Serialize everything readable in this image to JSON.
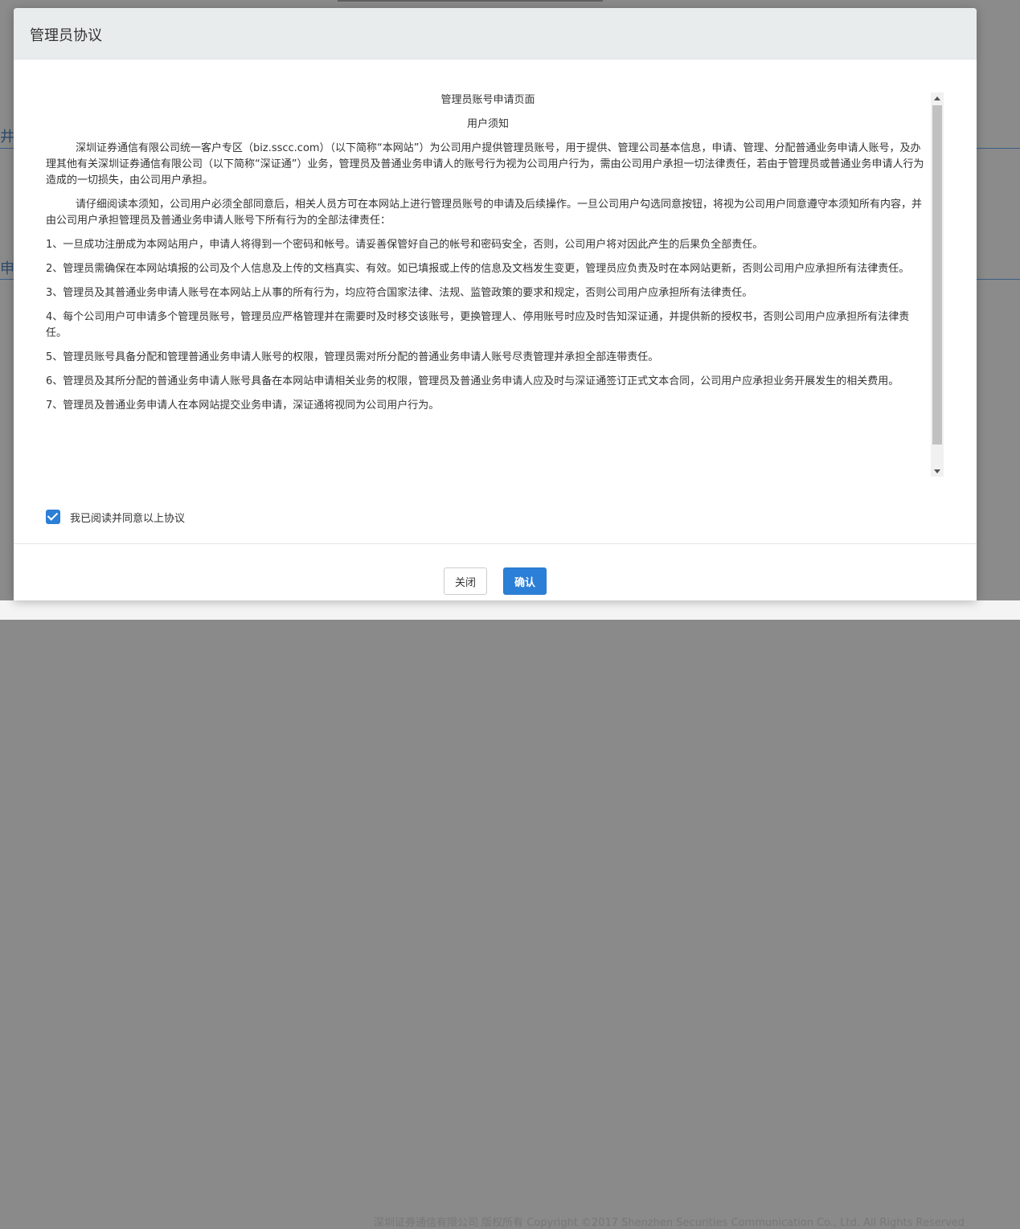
{
  "background": {
    "left_fragment_1": "井",
    "left_fragment_2": "申请",
    "footer_text": "深圳证券通信有限公司 版权所有  Copyright ©2017 Shenzhen Securities Communication Co., Ltd. All Rights Reserved"
  },
  "modal": {
    "title": "管理员协议",
    "doc_title": "管理员账号申请页面",
    "doc_subtitle": "用户须知",
    "paragraph_1": "深圳证券通信有限公司统一客户专区（biz.sscc.com）（以下简称“本网站”）为公司用户提供管理员账号，用于提供、管理公司基本信息，申请、管理、分配普通业务申请人账号，及办理其他有关深圳证券通信有限公司（以下简称“深证通”）业务，管理员及普通业务申请人的账号行为视为公司用户行为，需由公司用户承担一切法律责任，若由于管理员或普通业务申请人行为造成的一切损失，由公司用户承担。",
    "paragraph_2": "请仔细阅读本须知，公司用户必须全部同意后，相关人员方可在本网站上进行管理员账号的申请及后续操作。一旦公司用户勾选同意按钮，将视为公司用户同意遵守本须知所有内容，并由公司用户承担管理员及普通业务申请人账号下所有行为的全部法律责任：",
    "items": [
      "1、一旦成功注册成为本网站用户，申请人将得到一个密码和帐号。请妥善保管好自己的帐号和密码安全，否则，公司用户将对因此产生的后果负全部责任。",
      "2、管理员需确保在本网站填报的公司及个人信息及上传的文档真实、有效。如已填报或上传的信息及文档发生变更，管理员应负责及时在本网站更新，否则公司用户应承担所有法律责任。",
      "3、管理员及其普通业务申请人账号在本网站上从事的所有行为，均应符合国家法律、法规、监管政策的要求和规定，否则公司用户应承担所有法律责任。",
      "4、每个公司用户可申请多个管理员账号，管理员应严格管理并在需要时及时移交该账号，更换管理人、停用账号时应及时告知深证通，并提供新的授权书，否则公司用户应承担所有法律责任。",
      "5、管理员账号具备分配和管理普通业务申请人账号的权限，管理员需对所分配的普通业务申请人账号尽责管理并承担全部连带责任。",
      "6、管理员及其所分配的普通业务申请人账号具备在本网站申请相关业务的权限，管理员及普通业务申请人应及时与深证通签订正式文本合同，公司用户应承担业务开展发生的相关费用。",
      "7、管理员及普通业务申请人在本网站提交业务申请，深证通将视同为公司用户行为。"
    ],
    "agree_label": "我已阅读并同意以上协议",
    "agree_checked": true,
    "close_label": "关闭",
    "confirm_label": "确认",
    "accent_color": "#2c7fd6"
  }
}
